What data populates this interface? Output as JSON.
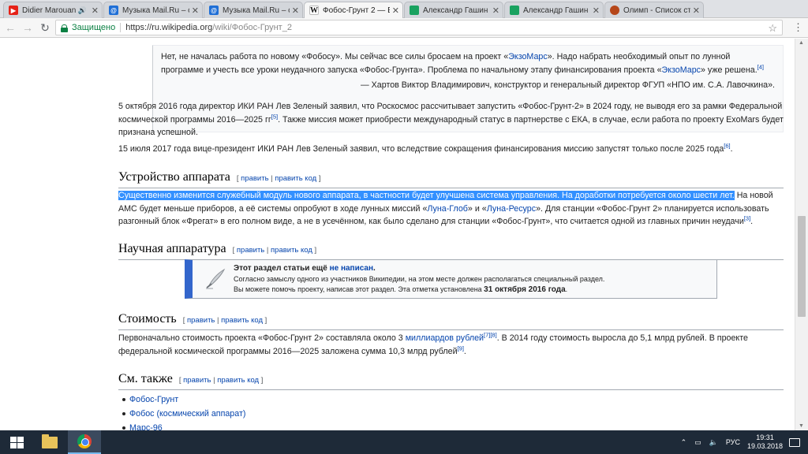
{
  "tabs": [
    {
      "title": "Didier Marouani",
      "icon": "youtube-icon"
    },
    {
      "title": "Музыка Mail.Ru – с",
      "icon": "mail-ru-icon"
    },
    {
      "title": "Музыка Mail.Ru – с",
      "icon": "mail-ru-icon"
    },
    {
      "title": "Фобос-Грунт 2 — В",
      "icon": "wikipedia-icon"
    },
    {
      "title": "Александр Гашин",
      "icon": "sheets-icon"
    },
    {
      "title": "Александр Гашин",
      "icon": "sheets-icon"
    },
    {
      "title": "Олимп - Список ст",
      "icon": "olimp-icon"
    }
  ],
  "omnibox": {
    "secure_label": "Защищено",
    "url_host": "https://ru.wikipedia.org",
    "url_path": "/wiki/Фобос-Грунт_2"
  },
  "quote": {
    "text_a": "Нет, не началась работа по новому «Фобосу». Мы сейчас все силы бросаем на проект «",
    "link_a": "ЭкзоМарс",
    "text_b": "». Надо набрать необходимый опыт по лунной программе и учесть все уроки неудачного запуска «Фобос-Грунта». Проблема по начальному этапу финансирования проекта «",
    "link_b": "ЭкзоМарс",
    "text_c": "» уже решена.",
    "ref": "[4]",
    "source": "— Хартов Виктор Владимирович, конструктор и генеральный директор ФГУП «НПО им. С.А. Лавочкина»."
  },
  "para1": {
    "text_a": "5 октября 2016 года директор ИКИ РАН Лев Зеленый заявил, что Роскосмос рассчитывает запустить «Фобос-Грунт-2» в 2024 году, не выводя его за рамки Федеральной космической программы 2016—2025 гг",
    "ref": "[5]",
    "text_b": ". Также миссия может приобрести международный статус в партнерстве с ЕКА, в случае, если работа по проекту ExoMars будет признана успешной."
  },
  "para2": {
    "text": "15 июля 2017 года вице-президент ИКИ РАН Лев Зеленый заявил, что вследствие сокращения финансирования миссию запустят только после 2025 года",
    "ref": "[6]",
    "end": "."
  },
  "edit": {
    "open": "[ ",
    "edit": "править",
    "sep": " | ",
    "edit_code": "править код",
    "close": " ]"
  },
  "sections": {
    "device": "Устройство аппарата",
    "science": "Научная аппаратура",
    "cost": "Стоимость",
    "see_also": "См. также"
  },
  "para3": {
    "highlighted": "Существенно изменится служебный модуль нового аппарата, в частности будет улучшена система управления. На доработки потребуется около шести лет.",
    "text_a": " На новой АМС будет меньше приборов, а её системы опробуют в ходе лунных миссий «",
    "link_a": "Луна-Глоб",
    "text_b": "» и «",
    "link_b": "Луна-Ресурс",
    "text_c": "». Для станции «Фобос-Грунт 2» планируется использовать разгонный блок «Фрегат» в его полном виде, а не в усечённом, как было сделано для станции «Фобос-Грунт», что считается одной из главных причин неудачи",
    "ref": "[3]",
    "end": "."
  },
  "ambox": {
    "title_a": "Этот раздел статьи ещё ",
    "title_b": "не написан",
    "title_c": ".",
    "line1": "Согласно замыслу одного из участников Википедии, на этом месте должен располагаться специальный раздел.",
    "line2_a": "Вы можете помочь проекту, написав этот раздел. Эта отметка установлена ",
    "line2_date": "31 октября 2016 года",
    "line2_b": "."
  },
  "para4": {
    "text_a": "Первоначально стоимость проекта «Фобос-Грунт 2» составляла около 3 ",
    "link": "миллиардов рублей",
    "refs": "[7][8]",
    "text_b": ". В 2014 году стоимость выросла до 5,1 млрд рублей. В проекте федеральной космической программы 2016—2025 заложена сумма 10,3 млрд рублей",
    "ref2": "[9]",
    "end": "."
  },
  "see_also": [
    "Фобос-Грунт",
    "Фобос (космический аппарат)",
    "Марс-96"
  ],
  "taskbar": {
    "lang": "РУС",
    "time": "19:31",
    "date": "19.03.2018"
  }
}
